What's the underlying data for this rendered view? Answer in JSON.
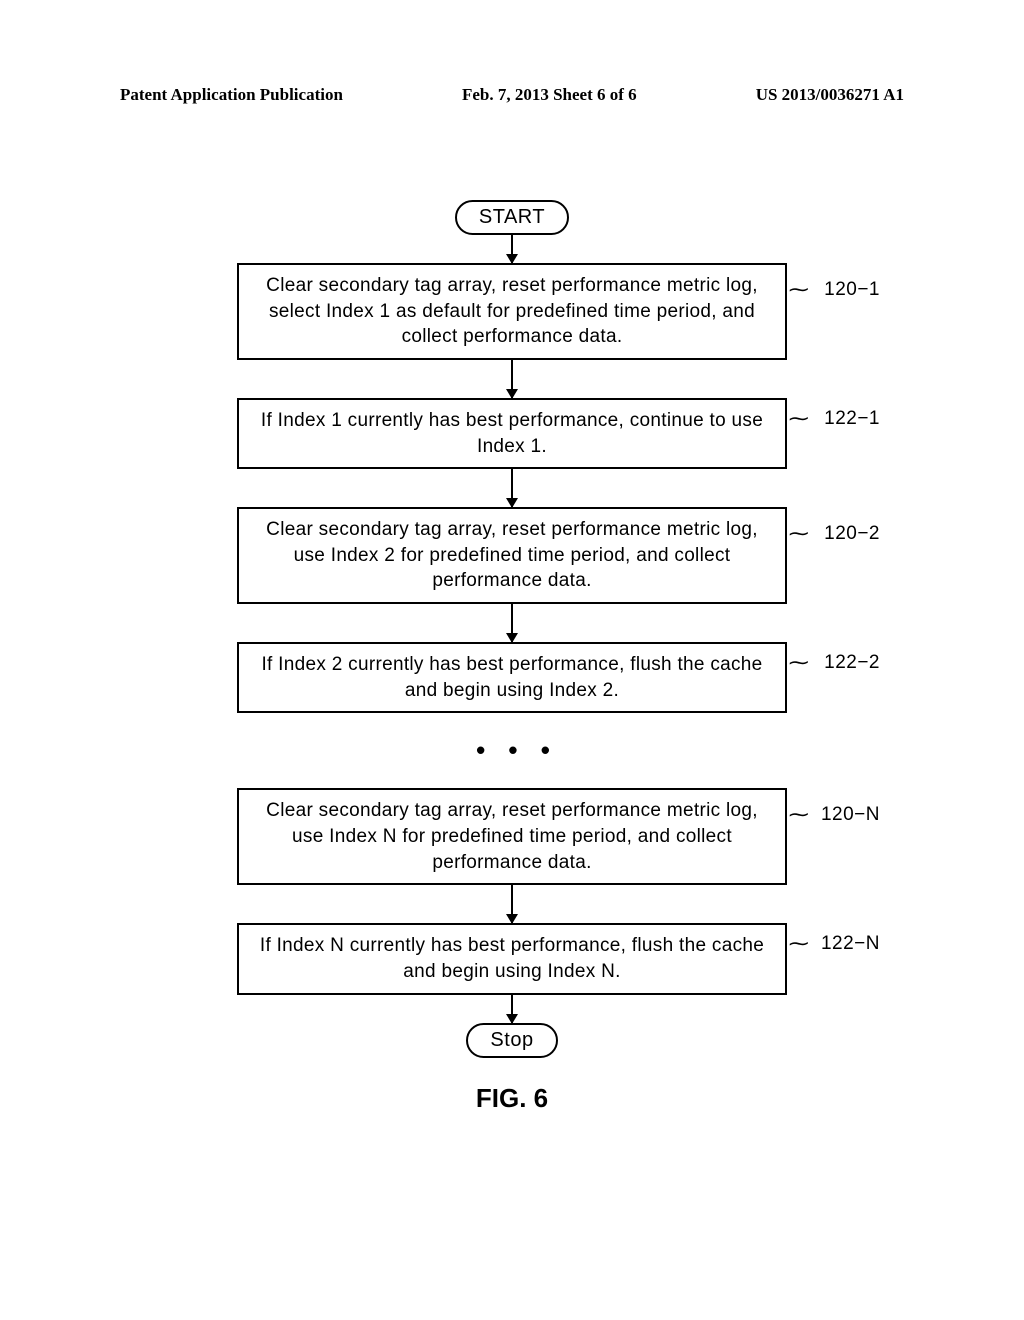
{
  "header": {
    "left": "Patent Application Publication",
    "center": "Feb. 7, 2013  Sheet 6 of 6",
    "right": "US 2013/0036271 A1"
  },
  "flowchart": {
    "start": "START",
    "stop": "Stop",
    "ellipsis": "• • •",
    "steps": [
      {
        "text": "Clear secondary tag array, reset performance metric log, select Index 1 as default for predefined time period, and collect performance data.",
        "label": "120−1"
      },
      {
        "text": "If Index 1 currently has best performance, continue to use Index 1.",
        "label": "122−1"
      },
      {
        "text": "Clear secondary tag array, reset performance metric log, use Index 2 for predefined time period, and collect performance data.",
        "label": "120−2"
      },
      {
        "text": "If Index 2 currently has best performance, flush the cache and begin using Index 2.",
        "label": "122−2"
      },
      {
        "text": "Clear secondary tag array, reset performance metric log, use Index N for predefined time period, and collect performance data.",
        "label": "120−N"
      },
      {
        "text": "If Index N currently has best performance, flush the cache and begin using Index N.",
        "label": "122−N"
      }
    ]
  },
  "figure": "FIG. 6",
  "chart_data": {
    "type": "flowchart",
    "title": "FIG. 6",
    "nodes": [
      {
        "id": "start",
        "type": "terminal",
        "text": "START"
      },
      {
        "id": "120-1",
        "type": "process",
        "text": "Clear secondary tag array, reset performance metric log, select Index 1 as default for predefined time period, and collect performance data.",
        "ref": "120-1"
      },
      {
        "id": "122-1",
        "type": "process",
        "text": "If Index 1 currently has best performance, continue to use Index 1.",
        "ref": "122-1"
      },
      {
        "id": "120-2",
        "type": "process",
        "text": "Clear secondary tag array, reset performance metric log, use Index 2 for predefined time period, and collect performance data.",
        "ref": "120-2"
      },
      {
        "id": "122-2",
        "type": "process",
        "text": "If Index 2 currently has best performance, flush the cache and begin using Index 2.",
        "ref": "122-2"
      },
      {
        "id": "ellipsis",
        "type": "continuation",
        "text": "..."
      },
      {
        "id": "120-N",
        "type": "process",
        "text": "Clear secondary tag array, reset performance metric log, use Index N for predefined time period, and collect performance data.",
        "ref": "120-N"
      },
      {
        "id": "122-N",
        "type": "process",
        "text": "If Index N currently has best performance, flush the cache and begin using Index N.",
        "ref": "122-N"
      },
      {
        "id": "stop",
        "type": "terminal",
        "text": "Stop"
      }
    ],
    "edges": [
      {
        "from": "start",
        "to": "120-1"
      },
      {
        "from": "120-1",
        "to": "122-1"
      },
      {
        "from": "122-1",
        "to": "120-2"
      },
      {
        "from": "120-2",
        "to": "122-2"
      },
      {
        "from": "122-2",
        "to": "ellipsis"
      },
      {
        "from": "ellipsis",
        "to": "120-N"
      },
      {
        "from": "120-N",
        "to": "122-N"
      },
      {
        "from": "122-N",
        "to": "stop"
      }
    ]
  }
}
